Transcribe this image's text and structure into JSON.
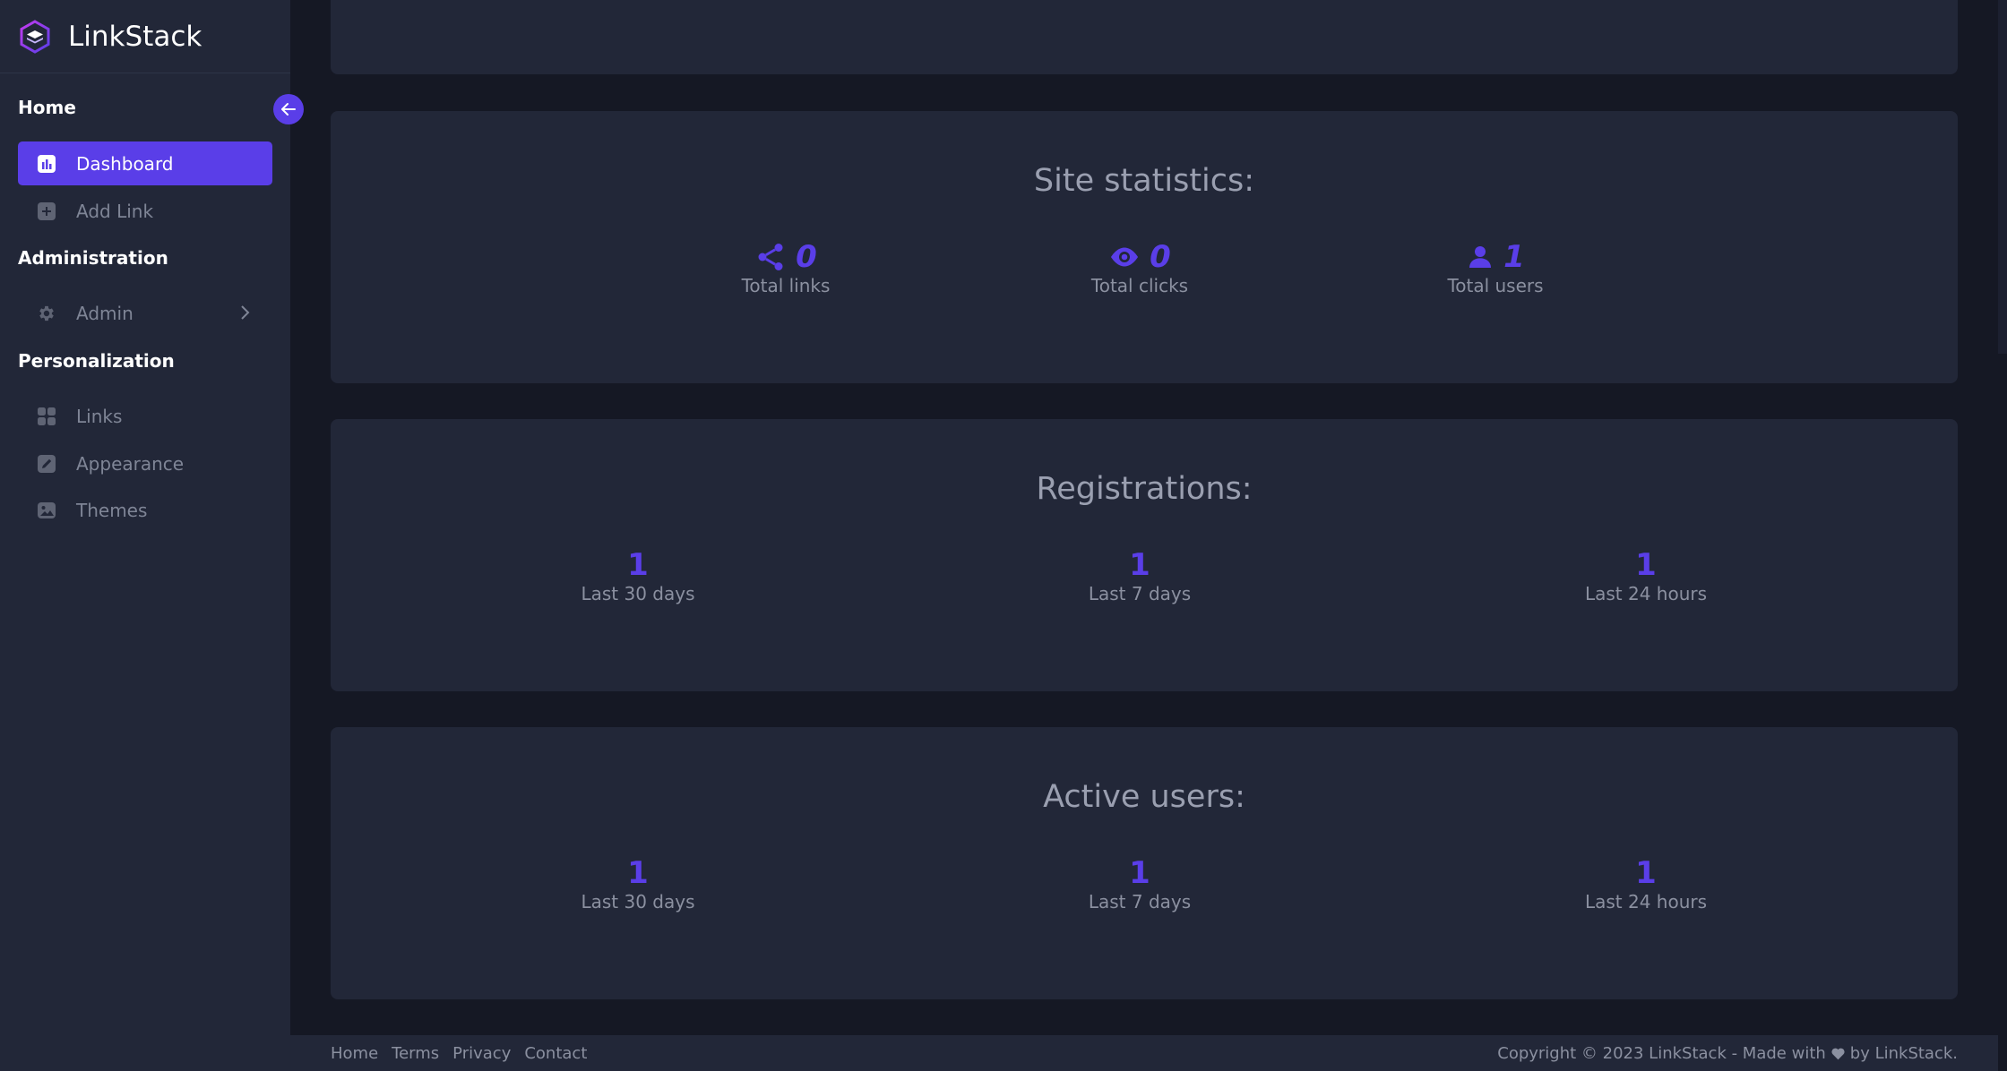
{
  "brand": {
    "name": "LinkStack"
  },
  "sidebar": {
    "sections": {
      "home": "Home",
      "administration": "Administration",
      "personalization": "Personalization"
    },
    "items": {
      "dashboard": "Dashboard",
      "add_link": "Add Link",
      "admin": "Admin",
      "links": "Links",
      "appearance": "Appearance",
      "themes": "Themes"
    }
  },
  "site_statistics": {
    "title": "Site statistics:",
    "stats": [
      {
        "icon": "share-icon",
        "value": "0",
        "label": "Total links"
      },
      {
        "icon": "eye-icon",
        "value": "0",
        "label": "Total clicks"
      },
      {
        "icon": "user-icon",
        "value": "1",
        "label": "Total users"
      }
    ]
  },
  "registrations": {
    "title": "Registrations:",
    "stats": [
      {
        "value": "1",
        "label": "Last 30 days"
      },
      {
        "value": "1",
        "label": "Last 7 days"
      },
      {
        "value": "1",
        "label": "Last 24 hours"
      }
    ]
  },
  "active_users": {
    "title": "Active users:",
    "stats": [
      {
        "value": "1",
        "label": "Last 30 days"
      },
      {
        "value": "1",
        "label": "Last 7 days"
      },
      {
        "value": "1",
        "label": "Last 24 hours"
      }
    ]
  },
  "footer": {
    "links": [
      "Home",
      "Terms",
      "Privacy",
      "Contact"
    ],
    "copyright_prefix": "Copyright © 2023 LinkStack - Made with",
    "copyright_suffix": "by LinkStack."
  },
  "colors": {
    "accent": "#5a3ee8",
    "sidebar_bg": "#222738",
    "page_bg": "#151824",
    "card_bg": "#222738"
  }
}
